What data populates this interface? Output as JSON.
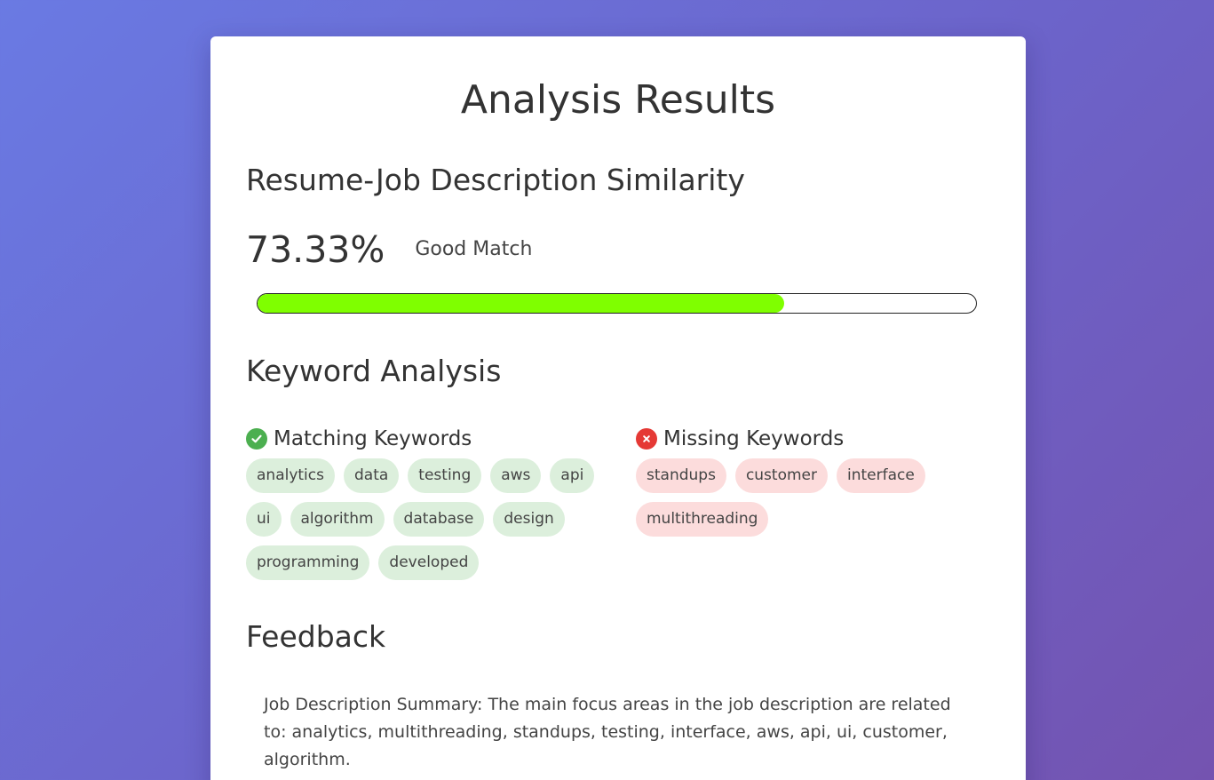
{
  "page": {
    "title": "Analysis Results"
  },
  "similarity": {
    "heading": "Resume-Job Description Similarity",
    "score_text": "73.33%",
    "score_fraction": 0.7333,
    "match_label": "Good Match",
    "bar_color": "#7fff00"
  },
  "keywords": {
    "heading": "Keyword Analysis",
    "matching": {
      "title": "Matching Keywords",
      "icon": "check-circle-icon",
      "color": "#4caf50",
      "items": [
        "analytics",
        "data",
        "testing",
        "aws",
        "api",
        "ui",
        "algorithm",
        "database",
        "design",
        "programming",
        "developed"
      ]
    },
    "missing": {
      "title": "Missing Keywords",
      "icon": "x-circle-icon",
      "color": "#e53935",
      "items": [
        "standups",
        "customer",
        "interface",
        "multithreading"
      ]
    }
  },
  "feedback": {
    "heading": "Feedback",
    "text": "Job Description Summary: The main focus areas in the job description are related to: analytics, multithreading, standups, testing, interface, aws, api, ui, customer, algorithm."
  }
}
